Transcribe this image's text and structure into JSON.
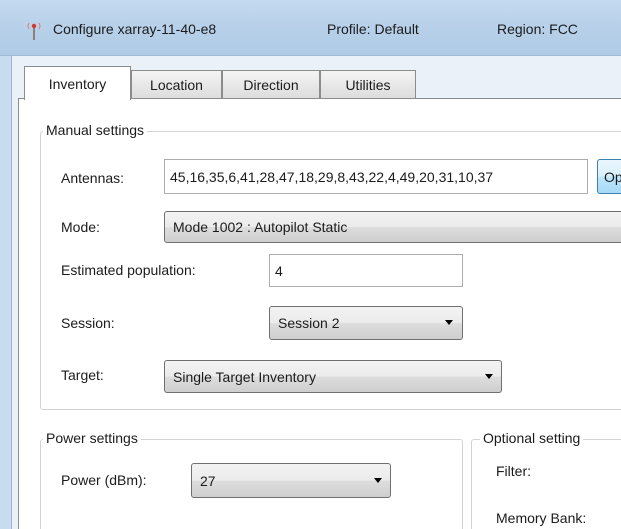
{
  "window": {
    "title": "Configure xarray-11-40-e8",
    "profile": "Profile: Default",
    "region": "Region: FCC"
  },
  "tabs": [
    {
      "label": "Inventory",
      "active": true
    },
    {
      "label": "Location",
      "active": false
    },
    {
      "label": "Direction",
      "active": false
    },
    {
      "label": "Utilities",
      "active": false
    }
  ],
  "manual_settings": {
    "title": "Manual settings",
    "antennas_label": "Antennas:",
    "antennas_value": "45,16,35,6,41,28,47,18,29,8,43,22,4,49,20,31,10,37",
    "options_button": "Op",
    "mode_label": "Mode:",
    "mode_value": "Mode 1002 : Autopilot Static",
    "population_label": "Estimated population:",
    "population_value": "4",
    "session_label": "Session:",
    "session_value": "Session 2",
    "target_label": "Target:",
    "target_value": "Single Target Inventory"
  },
  "power_settings": {
    "title": "Power settings",
    "power_label": "Power (dBm):",
    "power_value": "27"
  },
  "optional_settings": {
    "title": "Optional setting",
    "filter_label": "Filter:",
    "memory_bank_label": "Memory Bank:"
  }
}
